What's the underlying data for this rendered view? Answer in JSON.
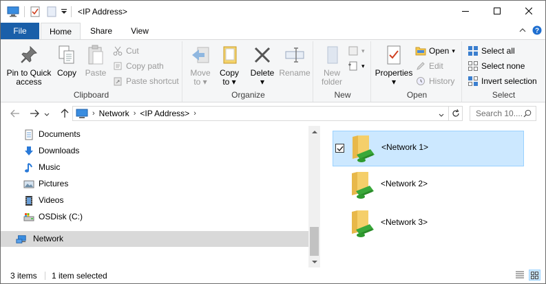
{
  "window": {
    "title": "<IP Address>",
    "controls": {
      "minimize": "minimize-icon",
      "maximize": "maximize-icon",
      "close": "close-icon"
    }
  },
  "tabs": [
    {
      "label": "File"
    },
    {
      "label": "Home"
    },
    {
      "label": "Share"
    },
    {
      "label": "View"
    }
  ],
  "ribbon": {
    "clipboard": {
      "label": "Clipboard",
      "pin_line1": "Pin to Quick",
      "pin_line2": "access",
      "copy": "Copy",
      "paste": "Paste",
      "cut": "Cut",
      "copy_path": "Copy path",
      "paste_shortcut": "Paste shortcut"
    },
    "organize": {
      "label": "Organize",
      "move_line1": "Move",
      "move_line2": "to",
      "copy_line1": "Copy",
      "copy_line2": "to",
      "delete": "Delete",
      "rename": "Rename"
    },
    "new": {
      "label": "New",
      "folder_line1": "New",
      "folder_line2": "folder"
    },
    "open": {
      "label": "Open",
      "properties": "Properties",
      "open": "Open",
      "edit": "Edit",
      "history": "History"
    },
    "select": {
      "label": "Select",
      "select_all": "Select all",
      "select_none": "Select none",
      "invert": "Invert selection"
    }
  },
  "address": {
    "crumbs": [
      "Network",
      "<IP Address>"
    ],
    "search_placeholder": "Search 10...."
  },
  "nav": {
    "items": [
      {
        "label": "Documents",
        "icon": "documents-icon"
      },
      {
        "label": "Downloads",
        "icon": "downloads-icon"
      },
      {
        "label": "Music",
        "icon": "music-icon"
      },
      {
        "label": "Pictures",
        "icon": "pictures-icon"
      },
      {
        "label": "Videos",
        "icon": "videos-icon"
      },
      {
        "label": "OSDisk (C:)",
        "icon": "drive-icon"
      },
      {
        "label": "Network",
        "icon": "network-icon",
        "selected": true
      }
    ]
  },
  "files": [
    {
      "name": "<Network 1>",
      "selected": true
    },
    {
      "name": "<Network 2>",
      "selected": false
    },
    {
      "name": "<Network 3>",
      "selected": false
    }
  ],
  "status": {
    "count": "3 items",
    "selection": "1 item selected"
  },
  "colors": {
    "accent": "#1a5fa9",
    "selection": "#cce8ff",
    "nav_selected": "#d9d9d9"
  }
}
